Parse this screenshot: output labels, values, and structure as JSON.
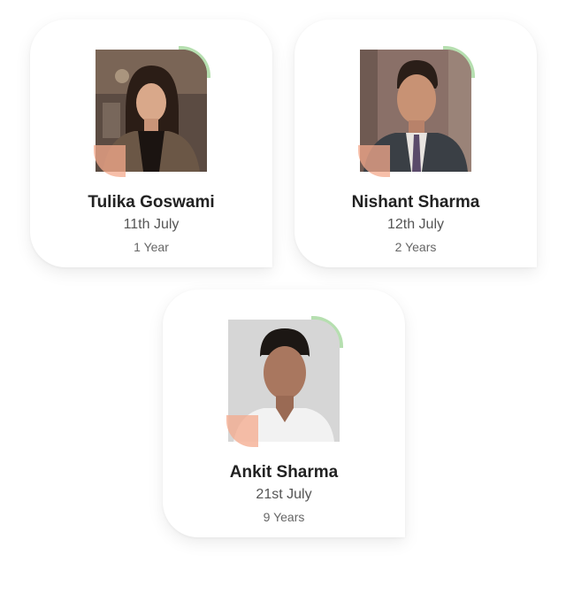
{
  "employees": [
    {
      "name": "Tulika Goswami",
      "date": "11th July",
      "tenure": "1 Year"
    },
    {
      "name": "Nishant Sharma",
      "date": "12th July",
      "tenure": "2 Years"
    },
    {
      "name": "Ankit Sharma",
      "date": "21st July",
      "tenure": "9 Years"
    }
  ],
  "colors": {
    "accent_green": "#b6dfb0",
    "accent_peach": "#f4aa8c"
  }
}
